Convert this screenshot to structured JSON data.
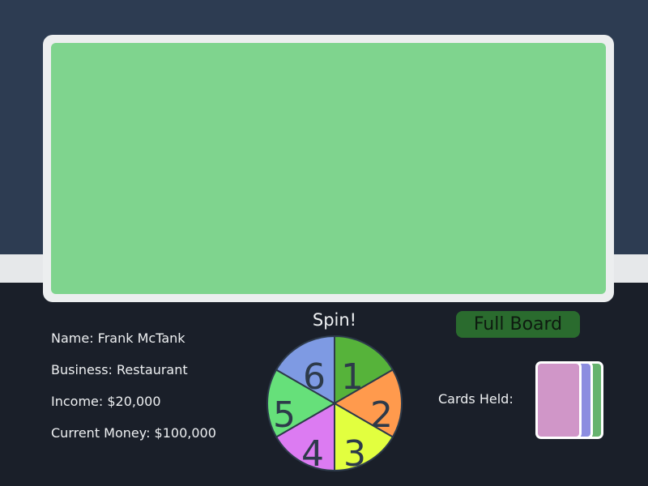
{
  "player": {
    "name": "Name: Frank McTank",
    "business": "Business: Restaurant",
    "income": "Income: $20,000",
    "money": "Current Money: $100,000"
  },
  "spinner": {
    "label": "Spin!",
    "segments": [
      {
        "number": "1",
        "color": "#56b33a"
      },
      {
        "number": "2",
        "color": "#ff9a4d"
      },
      {
        "number": "3",
        "color": "#e2ff3f"
      },
      {
        "number": "4",
        "color": "#dc7bf2"
      },
      {
        "number": "5",
        "color": "#66e07a"
      },
      {
        "number": "6",
        "color": "#7e9ae3"
      }
    ]
  },
  "full_board_button": "Full Board",
  "cards": {
    "label": "Cards Held:",
    "colors": [
      "#66b36e",
      "#8c8de0",
      "#d096c8"
    ]
  }
}
